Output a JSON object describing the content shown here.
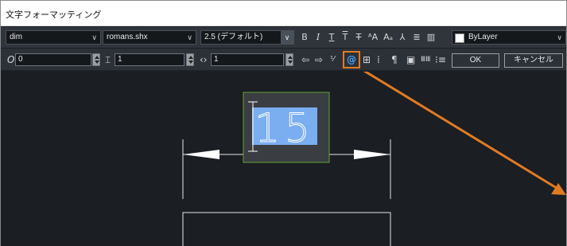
{
  "window": {
    "title": "文字フォーマッティング"
  },
  "toolbar_row1": {
    "style_value": "dim",
    "font_value": "romans.shx",
    "height_value": "2.5 (デフォルト)",
    "bold_icon": "bold-icon",
    "italic_icon": "italic-icon",
    "color_value": "ByLayer"
  },
  "toolbar_row2": {
    "oblique_value": "0",
    "tracking_value": "1",
    "width_value": "1",
    "ok_label": "OK",
    "cancel_label": "キャンセル"
  },
  "drawing": {
    "text_value": "15",
    "selection_color": "#7aaef0",
    "frame_color": "#5ea33a",
    "annotation_color": "#e07b24"
  }
}
